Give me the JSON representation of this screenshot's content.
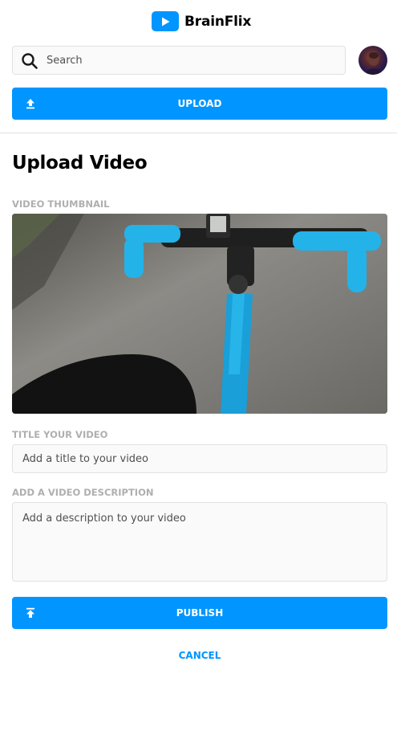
{
  "app": {
    "name": "BrainFlix"
  },
  "search": {
    "placeholder": "Search"
  },
  "header": {
    "upload_label": "UPLOAD"
  },
  "page": {
    "title": "Upload Video"
  },
  "form": {
    "thumbnail_label": "VIDEO THUMBNAIL",
    "title_label": "TITLE YOUR VIDEO",
    "title_placeholder": "Add a title to your video",
    "description_label": "ADD A VIDEO DESCRIPTION",
    "description_placeholder": "Add a description to your video",
    "publish_label": "PUBLISH",
    "cancel_label": "CANCEL"
  },
  "icons": {
    "logo": "play-icon",
    "search": "search-icon",
    "upload": "upload-icon",
    "publish": "publish-icon"
  },
  "colors": {
    "accent": "#0095ff",
    "label": "#afafaf",
    "field_bg": "#fafafa",
    "border": "#e1e1e1"
  }
}
